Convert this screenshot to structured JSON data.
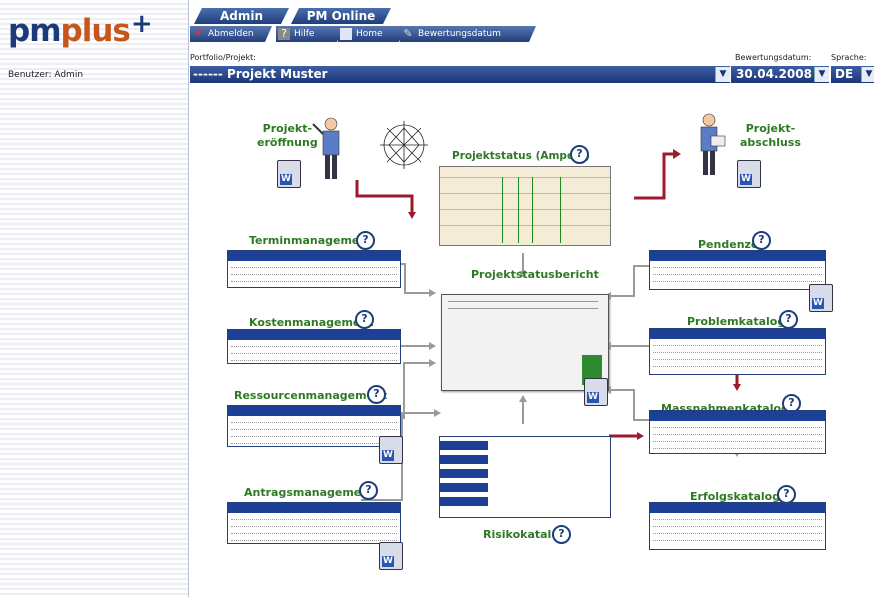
{
  "logo": {
    "pm": "pm",
    "plus": "plus",
    "sup": "+"
  },
  "user": "Benutzer: Admin",
  "tabs": [
    "Admin",
    "PM Online"
  ],
  "toolbar": {
    "abmelden": "Abmelden",
    "hilfe": "Hilfe",
    "home": "Home",
    "bewertung": "Bewertungsdatum"
  },
  "labels": {
    "portfolio": "Portfolio/Projekt:",
    "bewertungsdatum": "Bewertungsdatum:",
    "sprache": "Sprache:"
  },
  "selects": {
    "projekt": "------ Projekt Muster",
    "datum": "30.04.2008",
    "sprache": "DE"
  },
  "diagram": {
    "projekteroeffnung": [
      "Projekt-",
      "eröffnung"
    ],
    "projektabschluss": [
      "Projekt-",
      "abschluss"
    ],
    "projektstatus": "Projektstatus (Ampeln)",
    "projektstatusbericht": "Projektstatusbericht",
    "terminmanagement": "Terminmanagement",
    "kostenmanagement": "Kostenmanagement",
    "ressourcenmanagement": "Ressourcenmanagement",
    "antragsmanagement": "Antragsmanagement",
    "risikokatalog": "Risikokatalog",
    "pendenzen": "Pendenzen",
    "problemkatalog": "Problemkatalog",
    "massnahmenkatalog": "Massnahmenkatalog",
    "erfolgskatalog": "Erfolgskatalog",
    "help": "?"
  },
  "icons": {
    "close": "close-icon",
    "help": "help-icon",
    "home": "home-icon",
    "calendar": "calendar-icon",
    "dropdown": "chevron-down-icon",
    "word": "word-document-icon"
  },
  "colors": {
    "accent": "#1e3d7b",
    "title_green": "#2e7a23",
    "arrow_red": "#9b1b2a",
    "logo_orange": "#c7561e"
  }
}
